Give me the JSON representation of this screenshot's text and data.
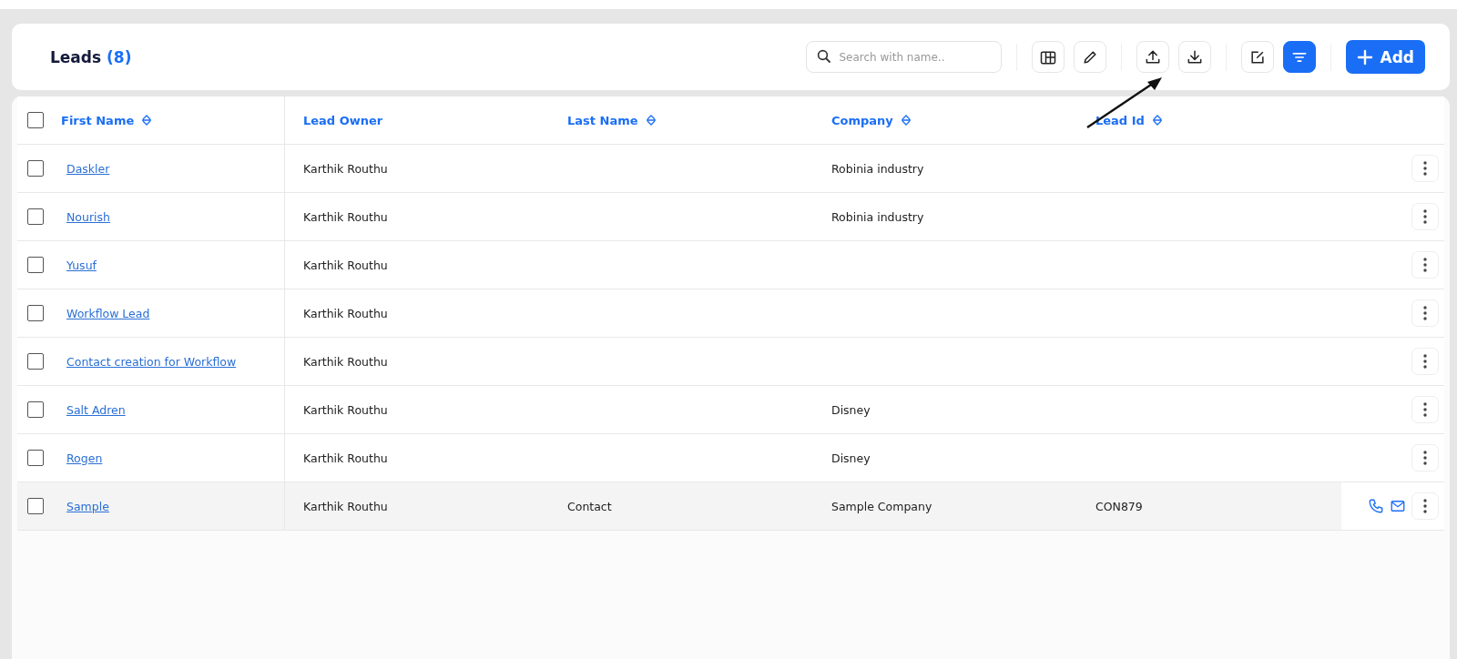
{
  "header": {
    "title": "Leads",
    "count": "(8)",
    "search": {
      "placeholder": "Search with name.."
    },
    "add_button": "Add",
    "filter_active": true
  },
  "table": {
    "select_all_checked": false,
    "columns": [
      {
        "label": "First Name",
        "sortable": true
      },
      {
        "label": "Lead Owner",
        "sortable": false
      },
      {
        "label": "Last Name",
        "sortable": true
      },
      {
        "label": "Company",
        "sortable": true
      },
      {
        "label": "Lead Id",
        "sortable": true
      }
    ],
    "rows": [
      {
        "checked": false,
        "hovered": false,
        "cells": [
          "Daskler",
          "Karthik Routhu",
          "",
          "Robinia industry",
          ""
        ]
      },
      {
        "checked": false,
        "hovered": false,
        "cells": [
          "Nourish",
          "Karthik Routhu",
          "",
          "Robinia industry",
          ""
        ]
      },
      {
        "checked": false,
        "hovered": false,
        "cells": [
          "Yusuf",
          "Karthik Routhu",
          "",
          "",
          ""
        ]
      },
      {
        "checked": false,
        "hovered": false,
        "cells": [
          "Workflow Lead",
          "Karthik Routhu",
          "",
          "",
          ""
        ]
      },
      {
        "checked": false,
        "hovered": false,
        "cells": [
          "Contact creation for Workflow",
          "Karthik Routhu",
          "",
          "",
          ""
        ]
      },
      {
        "checked": false,
        "hovered": false,
        "cells": [
          "Salt Adren",
          "Karthik Routhu",
          "",
          "Disney",
          ""
        ]
      },
      {
        "checked": false,
        "hovered": false,
        "cells": [
          "Rogen",
          "Karthik Routhu",
          "",
          "Disney",
          ""
        ]
      },
      {
        "checked": false,
        "hovered": true,
        "cells": [
          "Sample",
          "Karthik Routhu",
          "Contact",
          "Sample Company",
          "CON879"
        ]
      }
    ]
  }
}
